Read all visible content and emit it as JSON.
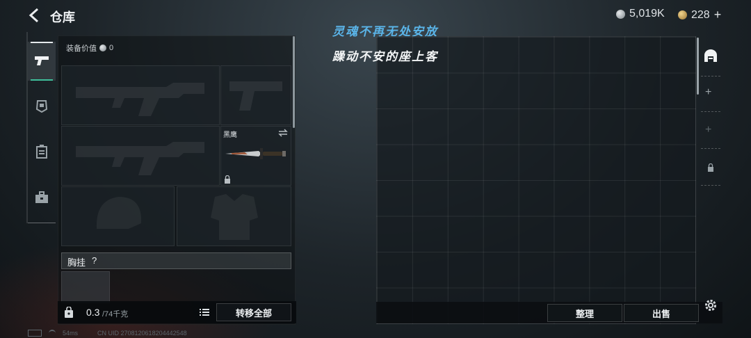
{
  "header": {
    "title": "仓库",
    "currency_silver": "5,019K",
    "currency_gold": "228",
    "currency_gold_plus": "+",
    "silver_color": "#9aa1a6",
    "gold_color": "#c7a25a"
  },
  "left_tabs": [
    {
      "icon": "pistol-icon",
      "selected": true
    },
    {
      "icon": "helmet-icon",
      "selected": false
    },
    {
      "icon": "backpack-icon",
      "selected": false
    },
    {
      "icon": "toolbox-icon",
      "selected": false
    }
  ],
  "loadout": {
    "value_label": "装备价值",
    "value": "0",
    "knife_name": "黑鹰",
    "chest_rig_label": "胸挂",
    "chest_rig_help": "?",
    "weight_value": "0.3",
    "weight_max": "/74千克",
    "transfer_all_label": "转移全部"
  },
  "overlay": {
    "line1": "灵魂不再无处安放",
    "line2": "躁动不安的座上客",
    "line1_color": "#5ab4e8"
  },
  "stash": {
    "sort_label": "整理",
    "sell_label": "出售"
  },
  "side_icons": [
    "stash-icon",
    "plus-icon",
    "plus-icon",
    "lock-icon"
  ],
  "footer": {
    "ping": "54ms",
    "uid": "CN UID 2708120618204442548"
  }
}
